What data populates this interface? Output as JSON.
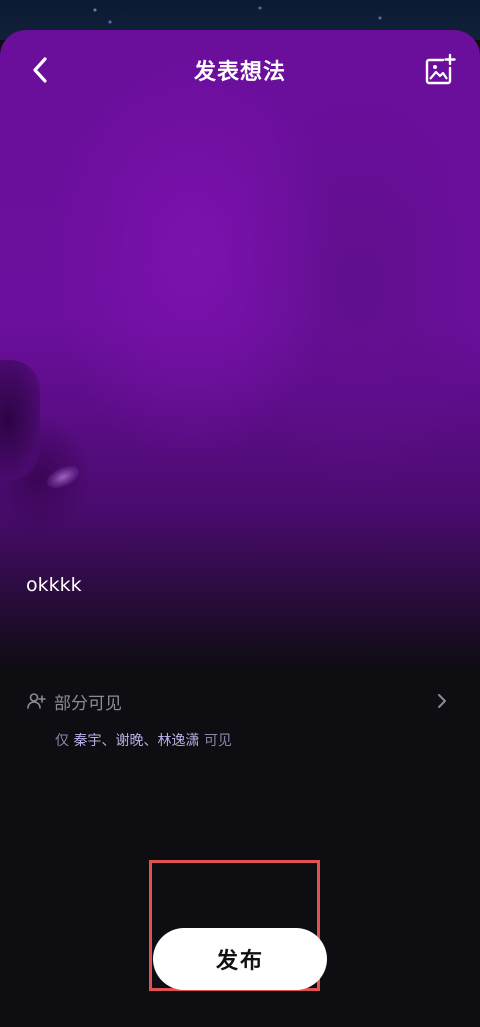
{
  "header": {
    "title": "发表想法"
  },
  "icons": {
    "back": "chevron-left-icon",
    "add_image": "add-image-icon",
    "visibility": "user-add-icon",
    "arrow": "chevron-right-icon"
  },
  "post": {
    "text": "okkkk"
  },
  "visibility": {
    "label": "部分可见",
    "prefix": "仅",
    "names": "秦宇、谢晚、林逸潇",
    "suffix": "可见"
  },
  "actions": {
    "publish_label": "发布"
  },
  "colors": {
    "hero_purple": "#6c0f9e",
    "background": "#0e0d12",
    "highlight_border": "#e0524f",
    "publish_bg": "#ffffff"
  }
}
